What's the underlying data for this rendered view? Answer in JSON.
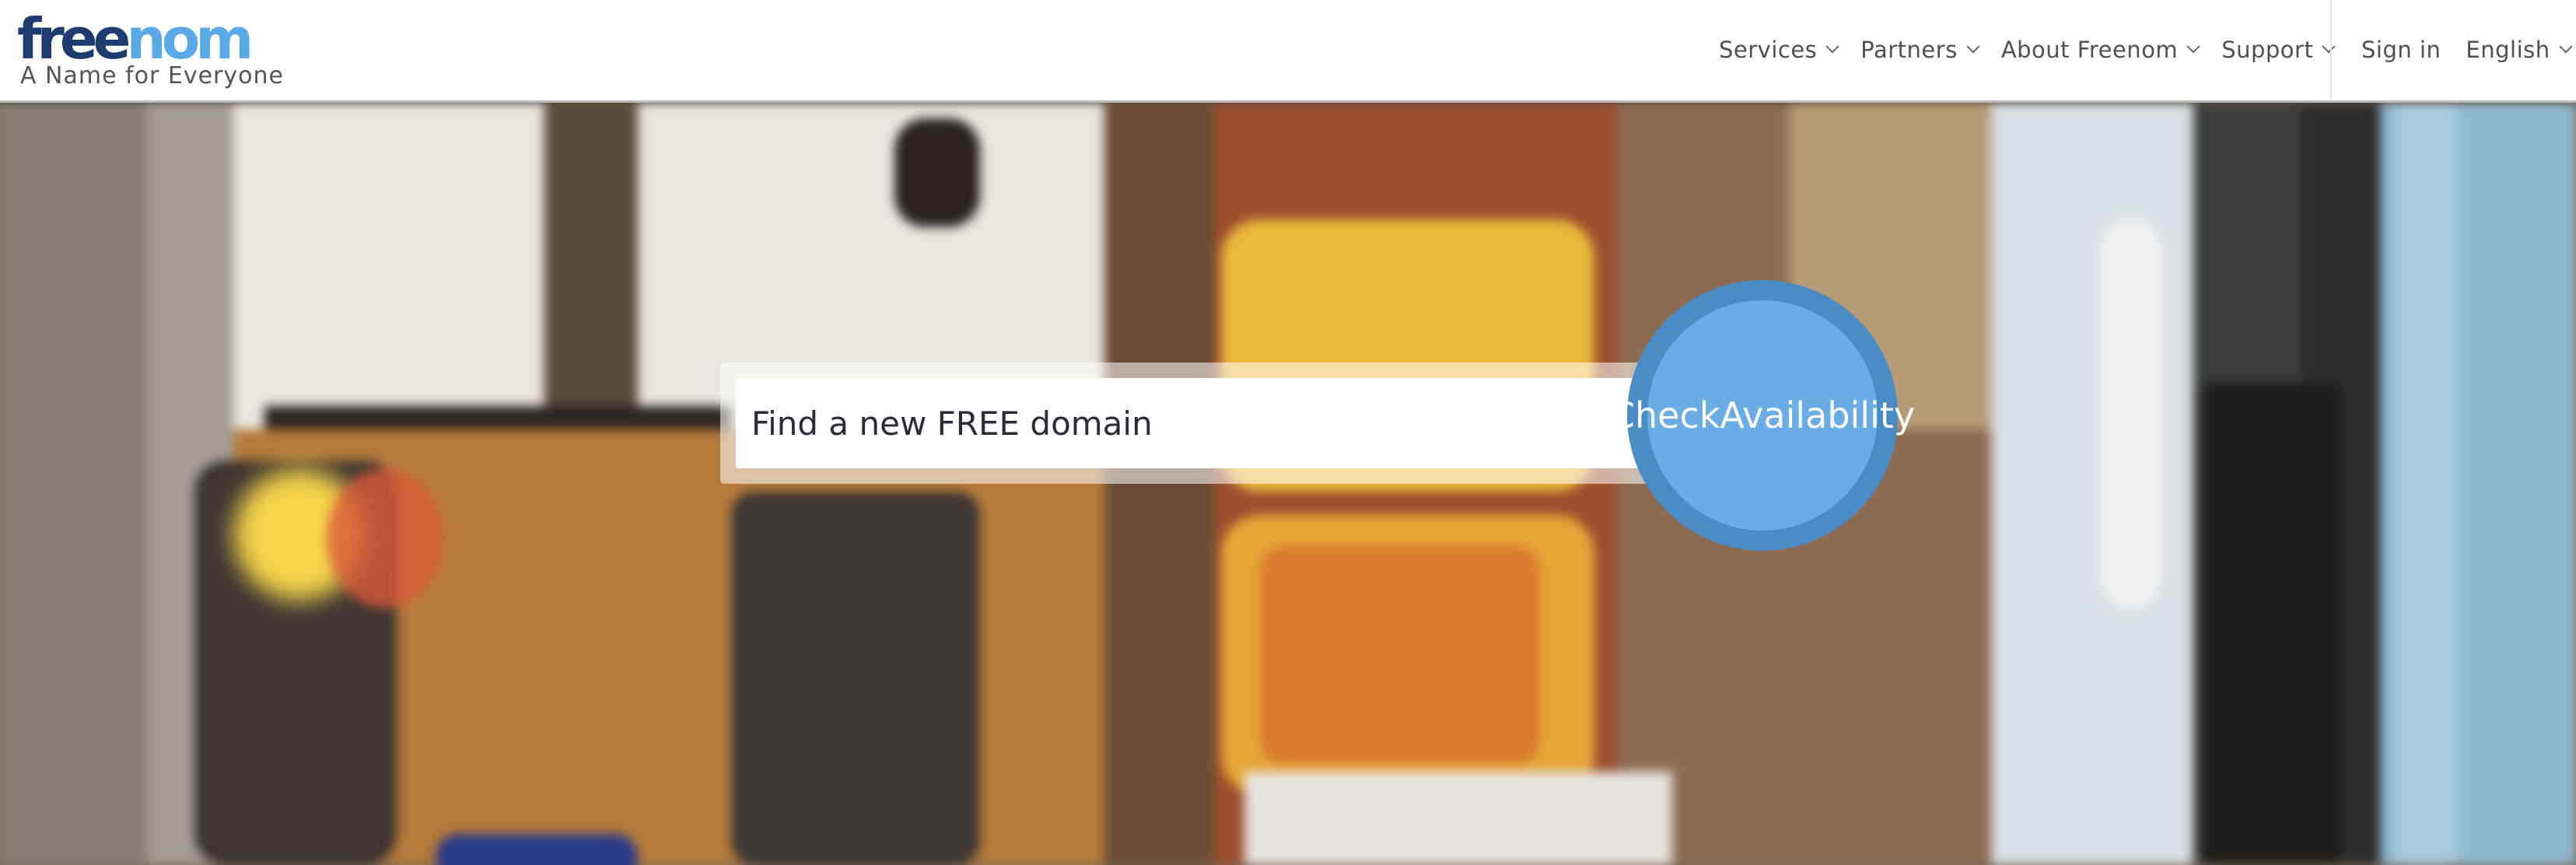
{
  "brand": {
    "logo_part1": "free",
    "logo_part2": "nom",
    "tagline": "A Name for Everyone",
    "color_dark": "#1d3b6e",
    "color_light": "#5aaae8"
  },
  "nav": {
    "items": [
      {
        "label": "Services",
        "icon": "chevron-down-icon"
      },
      {
        "label": "Partners",
        "icon": "chevron-down-icon"
      },
      {
        "label": "About Freenom",
        "icon": "chevron-down-icon"
      },
      {
        "label": "Support",
        "icon": "chevron-down-icon"
      }
    ],
    "sign_in": "Sign in",
    "language": "English"
  },
  "search": {
    "placeholder": "Find a new FREE domain",
    "value": ""
  },
  "check_button": {
    "line1": "Check",
    "line2": "Availability",
    "color": "#6aace5"
  }
}
